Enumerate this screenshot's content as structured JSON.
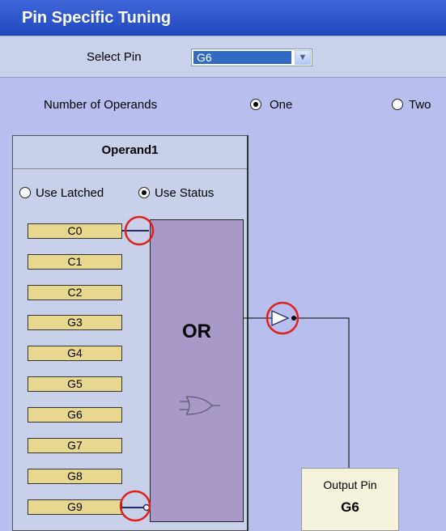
{
  "window": {
    "title": "Pin Specific Tuning"
  },
  "select_pin": {
    "label": "Select Pin",
    "value": "G6"
  },
  "operands": {
    "label": "Number of Operands",
    "options": [
      {
        "label": "One",
        "selected": true
      },
      {
        "label": "Two",
        "selected": false
      }
    ]
  },
  "operand1": {
    "title": "Operand1",
    "modes": [
      {
        "label": "Use Latched",
        "selected": false
      },
      {
        "label": "Use Status",
        "selected": true
      }
    ],
    "inputs": [
      "C0",
      "C1",
      "C2",
      "G3",
      "G4",
      "G5",
      "G6",
      "G7",
      "G8",
      "G9"
    ],
    "gate": "OR"
  },
  "output": {
    "label": "Output Pin",
    "value": "G6"
  },
  "colors": {
    "highlight_circle": "#e0201a",
    "wire": "#2a2a6a",
    "gate_fill": "#a999c9",
    "input_fill": "#e8d78e"
  }
}
